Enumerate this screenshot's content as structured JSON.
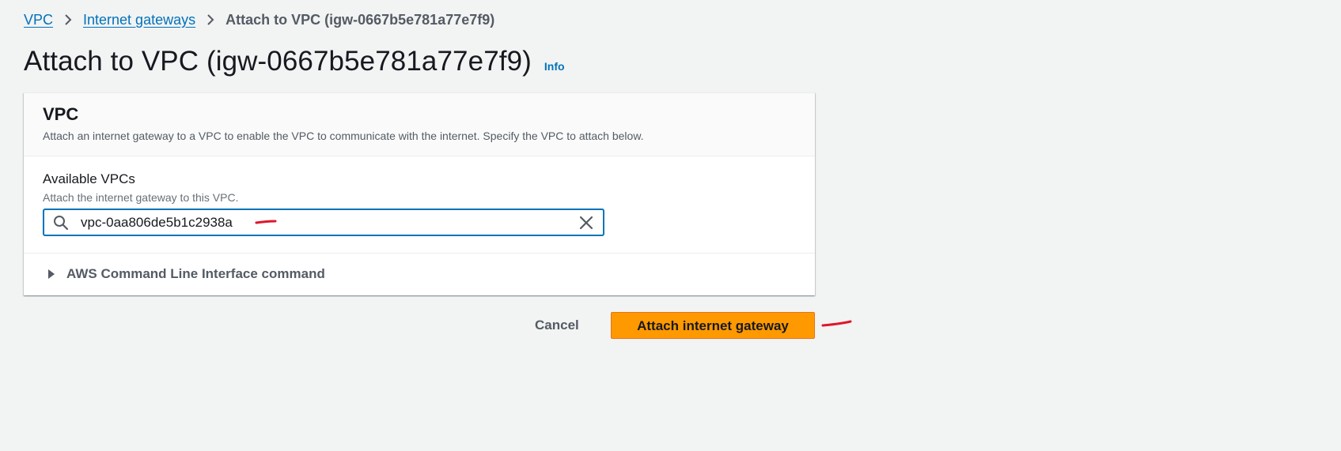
{
  "breadcrumb": {
    "items": [
      {
        "label": "VPC"
      },
      {
        "label": "Internet gateways"
      },
      {
        "label": "Attach to VPC (igw-0667b5e781a77e7f9)"
      }
    ]
  },
  "page": {
    "title": "Attach to VPC (igw-0667b5e781a77e7f9)",
    "info_label": "Info"
  },
  "panel": {
    "heading": "VPC",
    "description": "Attach an internet gateway to a VPC to enable the VPC to communicate with the internet. Specify the VPC to attach below.",
    "field": {
      "label": "Available VPCs",
      "description": "Attach the internet gateway to this VPC.",
      "value": "vpc-0aa806de5b1c2938a"
    },
    "cli": {
      "label": "AWS Command Line Interface command"
    }
  },
  "actions": {
    "cancel_label": "Cancel",
    "submit_label": "Attach internet gateway"
  },
  "colors": {
    "link": "#0073bb",
    "primary_button": "#ff9900",
    "annotation": "#e0162b",
    "background": "#f2f3f3"
  },
  "icons": {
    "breadcrumb_separator": "chevron-right-icon",
    "search": "search-icon",
    "clear": "close-icon",
    "expand": "caret-right-icon"
  }
}
